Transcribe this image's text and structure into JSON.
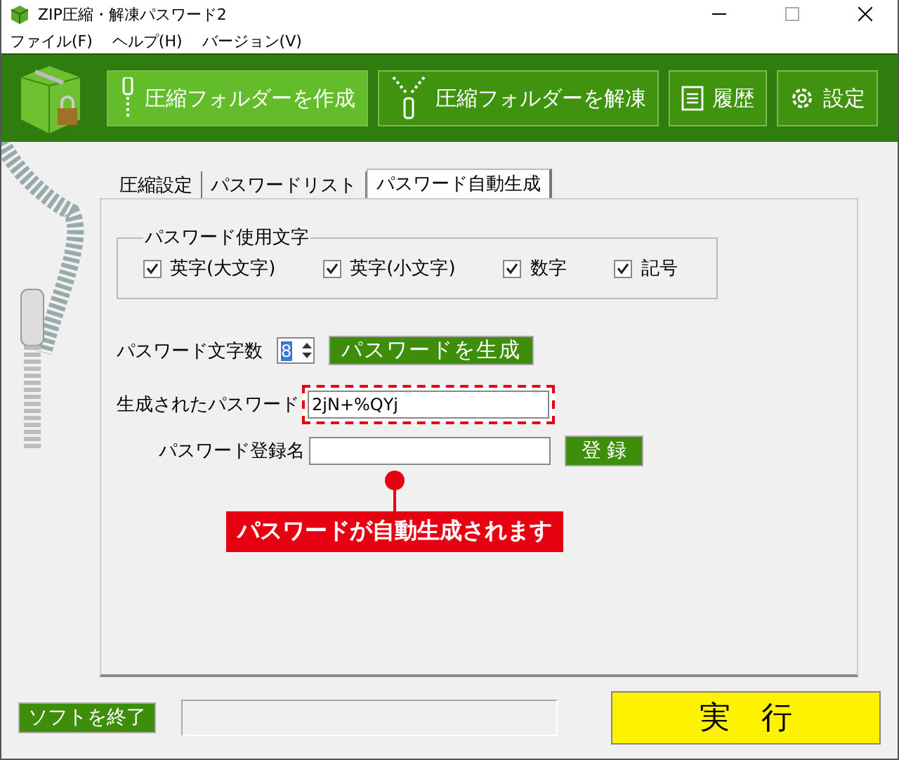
{
  "window": {
    "title": "ZIP圧縮・解凍パスワード2"
  },
  "menu": [
    "ファイル(F)",
    "ヘルプ(H)",
    "バージョン(V)"
  ],
  "toolbar": [
    {
      "label": "圧縮フォルダーを作成",
      "kind": "zip",
      "selected": true
    },
    {
      "label": "圧縮フォルダーを解凍",
      "kind": "unzip",
      "selected": false
    },
    {
      "label": "履歴",
      "kind": "history",
      "selected": false
    },
    {
      "label": "設定",
      "kind": "settings",
      "selected": false
    }
  ],
  "tabs": [
    {
      "label": "圧縮設定",
      "selected": false
    },
    {
      "label": "パスワードリスト",
      "selected": false
    },
    {
      "label": "パスワード自動生成",
      "selected": true
    }
  ],
  "charset_group": {
    "title": "パスワード使用文字",
    "options": [
      {
        "label": "英字(大文字)",
        "checked": true
      },
      {
        "label": "英字(小文字)",
        "checked": true
      },
      {
        "label": "数字",
        "checked": true
      },
      {
        "label": "記号",
        "checked": true
      }
    ]
  },
  "length": {
    "label": "パスワード文字数",
    "value": "8"
  },
  "generate_button": "パスワードを生成",
  "generated": {
    "label": "生成されたパスワード",
    "value": "2jN+%QYj"
  },
  "register": {
    "label": "パスワード登録名",
    "button": "登 録"
  },
  "callout": "パスワードが自動生成されます",
  "quit_button": "ソフトを終了",
  "run_button": "実　行"
}
